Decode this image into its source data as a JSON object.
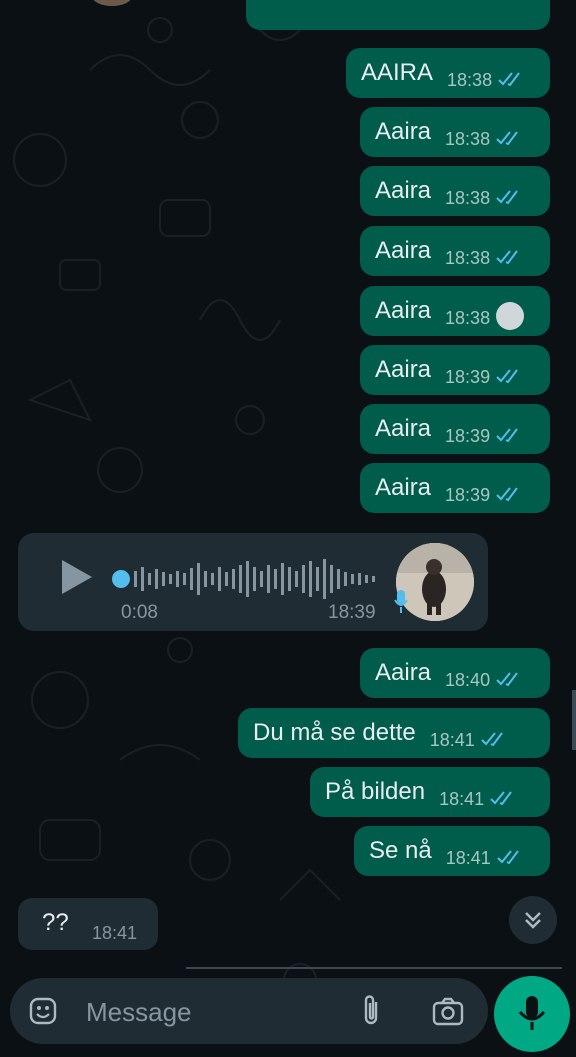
{
  "colors": {
    "outgoing_bubble": "#005c4b",
    "incoming_bubble": "#1f2c33",
    "read_ticks": "#53bdeb",
    "accent": "#00a884",
    "background": "#0b1014"
  },
  "messages": [
    {
      "text": "AAIRA",
      "time": "18:38",
      "status": "read"
    },
    {
      "text": "Aaira",
      "time": "18:38",
      "status": "read"
    },
    {
      "text": "Aaira",
      "time": "18:38",
      "status": "read"
    },
    {
      "text": "Aaira",
      "time": "18:38",
      "status": "read"
    },
    {
      "text": "Aaira",
      "time": "18:38",
      "status": "pending"
    },
    {
      "text": "Aaira",
      "time": "18:39",
      "status": "read"
    },
    {
      "text": "Aaira",
      "time": "18:39",
      "status": "read"
    },
    {
      "text": "Aaira",
      "time": "18:39",
      "status": "read"
    }
  ],
  "voice_note": {
    "duration": "0:08",
    "time": "18:39",
    "progress": 0
  },
  "messages_after": [
    {
      "text": "Aaira",
      "time": "18:40",
      "status": "read"
    },
    {
      "text": "Du må se dette",
      "time": "18:41",
      "status": "read"
    },
    {
      "text": "På bilden",
      "time": "18:41",
      "status": "read"
    },
    {
      "text": "Se nå",
      "time": "18:41",
      "status": "read"
    }
  ],
  "incoming_last": {
    "text": "??",
    "time": "18:41"
  },
  "composer": {
    "placeholder": "Message"
  },
  "icons": {
    "emoji": "sticker-icon",
    "attach": "paperclip-icon",
    "camera": "camera-icon",
    "mic": "microphone-icon",
    "scroll": "double-chevron-down-icon"
  }
}
